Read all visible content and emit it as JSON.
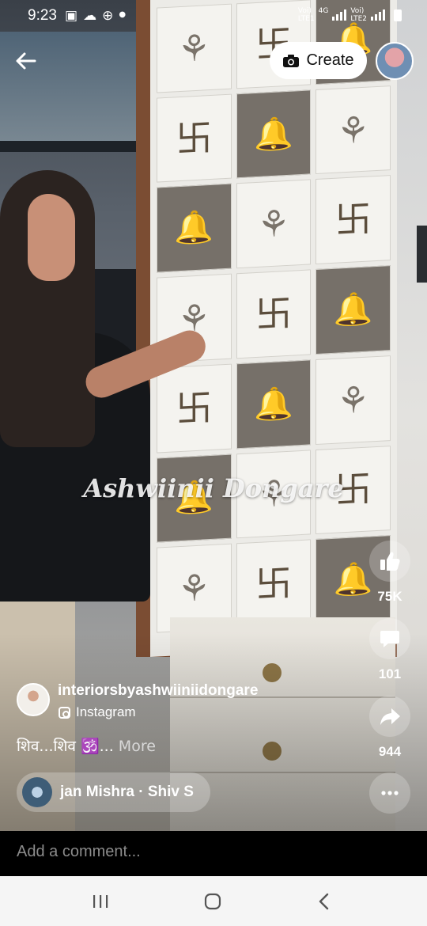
{
  "status_bar": {
    "time": "9:23",
    "notification_icons": [
      "gallery-icon",
      "cloud-icon",
      "vpn-icon",
      "dot-icon"
    ],
    "sim1_label": "Voi)",
    "sim1_sub": "LTE1",
    "network_type": "4G",
    "sim2_label": "Voi)",
    "sim2_sub": "LTE2"
  },
  "header": {
    "create_label": "Create"
  },
  "video": {
    "watermark": "Ashwiinii Dongare"
  },
  "actions": {
    "like_count": "75K",
    "comment_count": "101",
    "share_count": "944"
  },
  "creator": {
    "name": "interiorsbyashwiiniidongare",
    "source": "Instagram"
  },
  "caption": {
    "text": "शिव...शिव 🕉️...",
    "more_label": "More"
  },
  "music": {
    "track": "jan Mishra · Shiv S"
  },
  "comment": {
    "placeholder": "Add a comment..."
  },
  "colors": {
    "accent": "#ffffff",
    "comment_bg": "#000000",
    "nav_bg": "#f5f5f5"
  }
}
